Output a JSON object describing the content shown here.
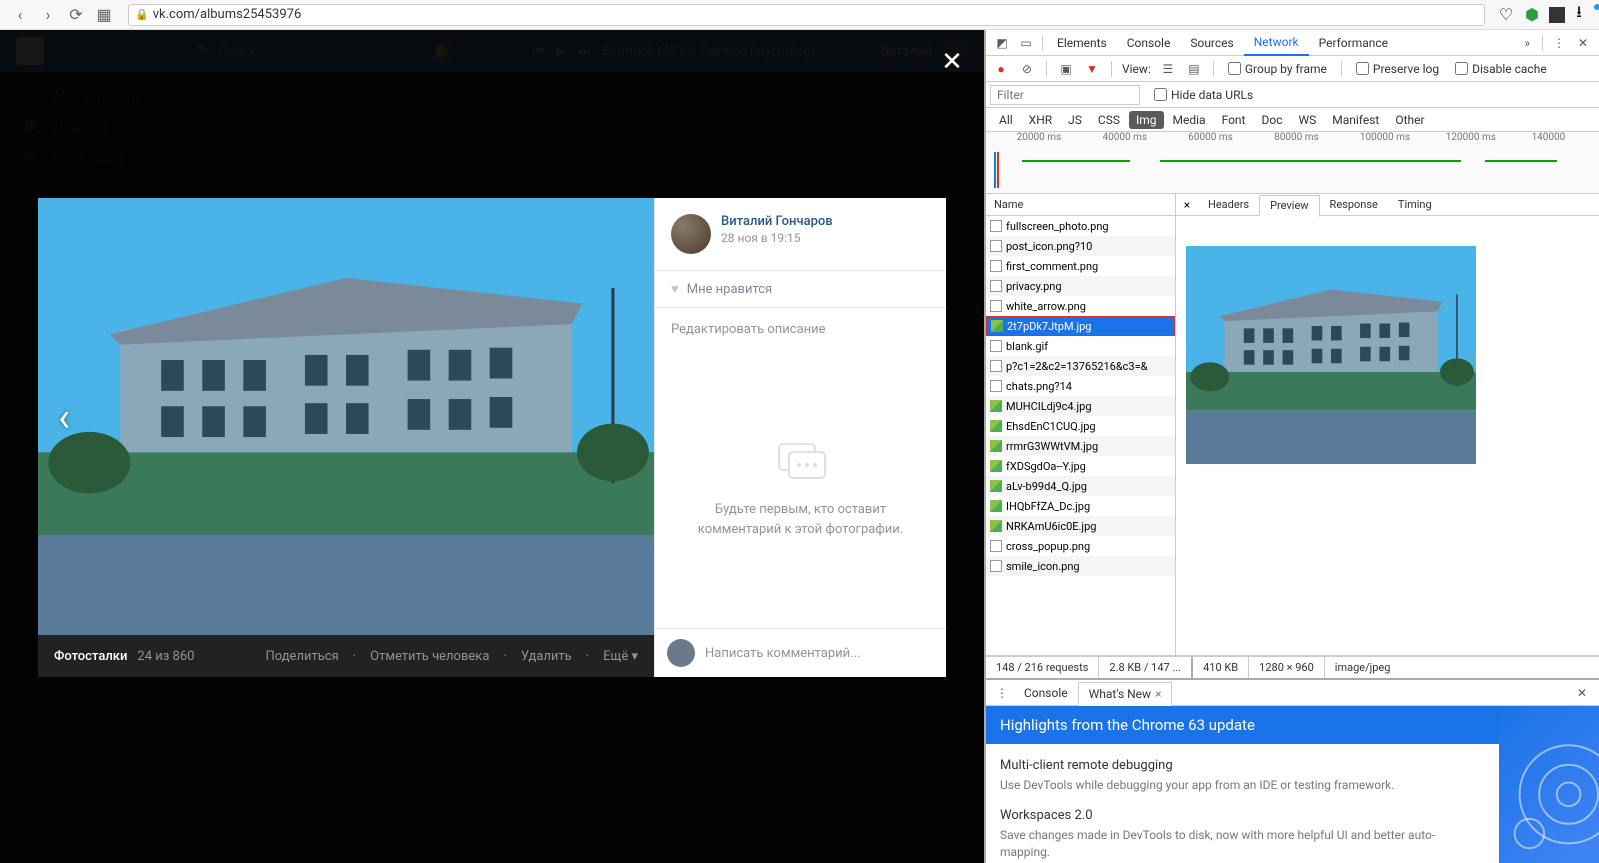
{
  "browser": {
    "url": "vk.com/albums25453976"
  },
  "vk": {
    "search_placeholder": "Поиск",
    "now_playing": "Bomfunk MC's – Reverse Psychology",
    "username": "Виталий",
    "nav": [
      {
        "label": "Моя Страница"
      },
      {
        "label": "Новости"
      },
      {
        "label": "Сообщения"
      }
    ]
  },
  "photo": {
    "author_name": "Виталий Гончаров",
    "author_date": "28 ноя в 19:15",
    "like_label": "Мне нравится",
    "edit_desc": "Редактировать описание",
    "empty_comments": "Будьте первым, кто оставит комментарий к этой фотографии.",
    "comment_placeholder": "Написать комментарий...",
    "album_label": "Фотосталки",
    "counter": "24 из 860",
    "actions": {
      "share": "Поделиться",
      "tag": "Отметить человека",
      "delete": "Удалить",
      "more": "Ещё"
    }
  },
  "devtools": {
    "tabs": [
      "Elements",
      "Console",
      "Sources",
      "Network",
      "Performance"
    ],
    "active_tab": "Network",
    "toolbar": {
      "view_label": "View:",
      "group_by_frame": "Group by frame",
      "preserve_log": "Preserve log",
      "disable_cache": "Disable cache"
    },
    "filter_placeholder": "Filter",
    "hide_data_urls": "Hide data URLs",
    "types": [
      "All",
      "XHR",
      "JS",
      "CSS",
      "Img",
      "Media",
      "Font",
      "Doc",
      "WS",
      "Manifest",
      "Other"
    ],
    "active_type": "Img",
    "timeline_labels": [
      "20000 ms",
      "40000 ms",
      "60000 ms",
      "80000 ms",
      "100000 ms",
      "120000 ms",
      "140000"
    ],
    "col_name": "Name",
    "requests": [
      {
        "name": "fullscreen_photo.png",
        "type": "doc"
      },
      {
        "name": "post_icon.png?10",
        "type": "doc"
      },
      {
        "name": "first_comment.png",
        "type": "doc"
      },
      {
        "name": "privacy.png",
        "type": "doc"
      },
      {
        "name": "white_arrow.png",
        "type": "doc"
      },
      {
        "name": "2t7pDk7JtpM.jpg",
        "type": "img",
        "selected": true
      },
      {
        "name": "blank.gif",
        "type": "doc"
      },
      {
        "name": "p?c1=2&c2=13765216&c3=&",
        "type": "doc"
      },
      {
        "name": "chats.png?14",
        "type": "doc"
      },
      {
        "name": "MUHCILdj9c4.jpg",
        "type": "img"
      },
      {
        "name": "EhsdEnC1CUQ.jpg",
        "type": "img"
      },
      {
        "name": "rrmrG3WWtVM.jpg",
        "type": "img"
      },
      {
        "name": "fXDSgdOa--Y.jpg",
        "type": "img"
      },
      {
        "name": "aLv-b99d4_Q.jpg",
        "type": "img"
      },
      {
        "name": "IHQbFfZA_Dc.jpg",
        "type": "img"
      },
      {
        "name": "NRKAmU6ic0E.jpg",
        "type": "img"
      },
      {
        "name": "cross_popup.png",
        "type": "doc"
      },
      {
        "name": "smile_icon.png",
        "type": "doc"
      }
    ],
    "preview_tabs": [
      "Headers",
      "Preview",
      "Response",
      "Timing"
    ],
    "active_preview_tab": "Preview",
    "status": {
      "requests": "148 / 216 requests",
      "size": "2.8 KB / 147 ...",
      "resource_size": "410 KB",
      "dimensions": "1280 × 960",
      "mime": "image/jpeg"
    },
    "drawer": {
      "tabs": [
        "Console",
        "What's New"
      ],
      "active": "What's New",
      "headline": "Highlights from the Chrome 63 update",
      "items": [
        {
          "title": "Multi-client remote debugging",
          "desc": "Use DevTools while debugging your app from an IDE or testing framework."
        },
        {
          "title": "Workspaces 2.0",
          "desc": "Save changes made in DevTools to disk, now with more helpful UI and better auto-mapping."
        }
      ]
    }
  }
}
